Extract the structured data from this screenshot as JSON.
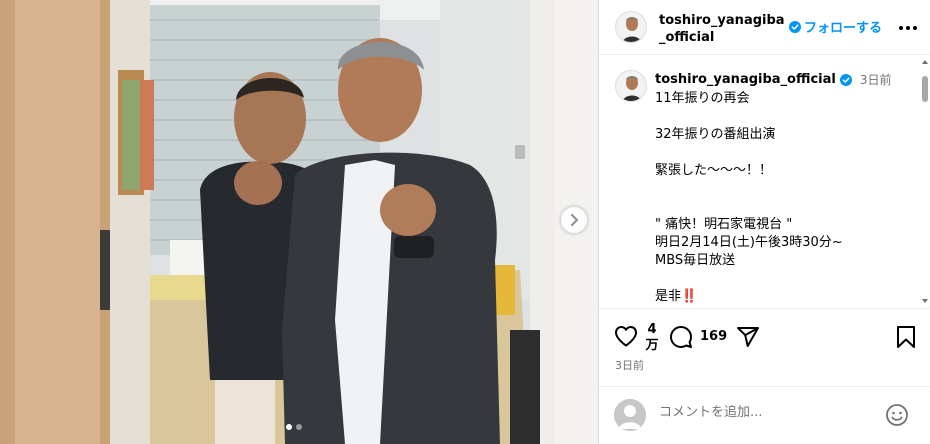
{
  "post": {
    "username": "toshiro_yanagiba_official",
    "follow_label": "フォローする",
    "caption_username": "toshiro_yanagiba_official",
    "caption_time": "3日前",
    "caption_text": "11年振りの再会\n\n32年振りの番組出演\n\n緊張した〜〜〜！！\n\n\n\" 痛快！明石家電視台 \"\n明日2月14日(土)午後3時30分~\nMBS毎日放送\n\n是非‼️",
    "likes_line1": "4",
    "likes_line2": "万",
    "comments_count": "169",
    "posted_time": "3日前",
    "comment_placeholder": "コメントを追加...",
    "carousel": {
      "total_slides": 2,
      "active_slide": 1
    }
  },
  "colors": {
    "accent": "#0095f6",
    "verified": "#0095f6",
    "secondary_text": "#737373"
  },
  "icons": [
    "verified-badge-icon",
    "more-options-icon",
    "heart-icon",
    "comment-icon",
    "share-icon",
    "bookmark-icon",
    "emoji-icon",
    "chevron-right-icon"
  ]
}
